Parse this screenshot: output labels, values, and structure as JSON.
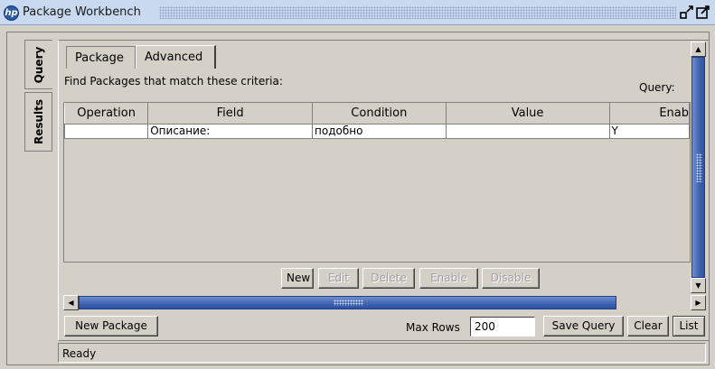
{
  "window": {
    "title": "Package Workbench",
    "logo_text": "hp",
    "accent": "#2a5ba8"
  },
  "side_tabs": [
    {
      "label": "Query",
      "active": true
    },
    {
      "label": "Results",
      "active": false
    }
  ],
  "tabs": [
    {
      "label": "Package",
      "active": false
    },
    {
      "label": "Advanced",
      "active": true
    }
  ],
  "criteria_label": "Find Packages that match these criteria:",
  "query_label": "Query:",
  "grid": {
    "columns": [
      "Operation",
      "Field",
      "Condition",
      "Value",
      "Enab"
    ],
    "rows": [
      [
        "",
        "Описание:",
        "подобно",
        "",
        "Y"
      ]
    ]
  },
  "row_buttons": [
    {
      "label": "New",
      "enabled": true
    },
    {
      "label": "Edit",
      "enabled": false
    },
    {
      "label": "Delete",
      "enabled": false
    },
    {
      "label": "Enable",
      "enabled": false
    },
    {
      "label": "Disable",
      "enabled": false
    }
  ],
  "bottom": {
    "new_package": "New Package",
    "max_rows_label": "Max Rows",
    "max_rows_value": "200",
    "save_query": "Save Query",
    "clear": "Clear",
    "list": "List"
  },
  "status": "Ready",
  "icons": {
    "restore": "restore-icon",
    "maximize": "maximize-icon"
  }
}
